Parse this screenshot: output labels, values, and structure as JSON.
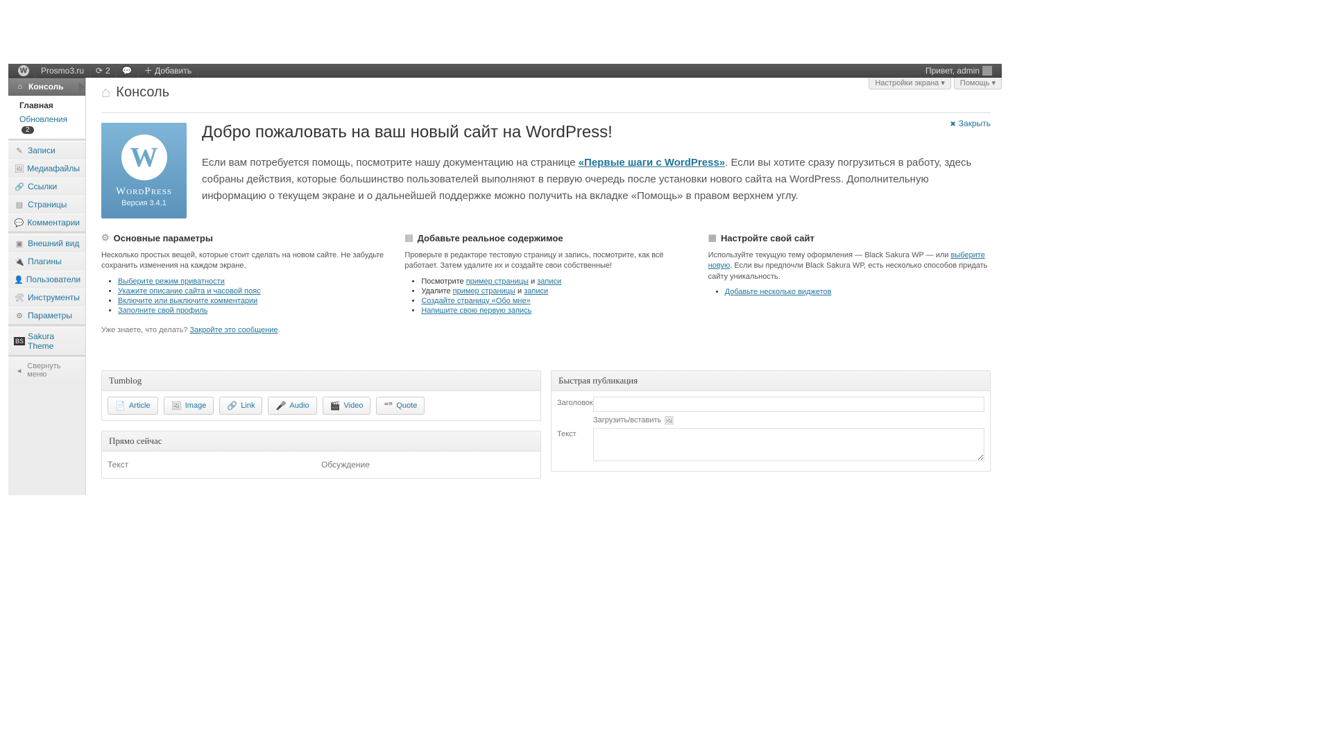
{
  "adminbar": {
    "site_name": "Prosmo3.ru",
    "updates_count": "2",
    "add_new": "Добавить",
    "greeting": "Привет, admin"
  },
  "screen_options": "Настройки экрана",
  "help": "Помощь",
  "sidebar": {
    "console": "Консоль",
    "main": "Главная",
    "updates": "Обновления",
    "updates_badge": "2",
    "posts": "Записи",
    "media": "Медиафайлы",
    "links": "Ссылки",
    "pages": "Страницы",
    "comments": "Комментарии",
    "appearance": "Внешний вид",
    "plugins": "Плагины",
    "users": "Пользователи",
    "tools": "Инструменты",
    "settings": "Параметры",
    "sakura": "Sakura Theme",
    "collapse": "Свернуть меню"
  },
  "page_title": "Консоль",
  "welcome": {
    "dismiss": "Закрыть",
    "badge_name": "WordPress",
    "badge_version": "Версия 3.4.1",
    "heading": "Добро пожаловать на ваш новый сайт на WordPress!",
    "intro_1": "Если вам потребуется помощь, посмотрите нашу документацию на странице ",
    "intro_link": "«Первые шаги с WordPress»",
    "intro_2": ". Если вы хотите сразу погрузиться в работу, здесь собраны действия, которые большинство пользователей выполняют в первую очередь после установки нового сайта на WordPress. Дополнительную информацию о текущем экране и о дальнейшей поддержке можно получить на вкладке «Помощь» в правом верхнем углу.",
    "col1": {
      "title": "Основные параметры",
      "desc": "Несколько простых вещей, которые стоит сделать на новом сайте. Не забудьте сохранить изменения на каждом экране.",
      "items": [
        "Выберите режим приватности",
        "Укажите описание сайта и часовой пояс",
        "Включите или выключите комментарии",
        "Заполните свой профиль"
      ]
    },
    "col2": {
      "title": "Добавьте реальное содержимое",
      "desc": "Проверьте в редакторе тестовую страницу и запись, посмотрите, как всё работает. Затем удалите их и создайте свои собственные!",
      "i1a": "Посмотрите ",
      "i1b": "пример страницы",
      "i1c": " и ",
      "i1d": "записи",
      "i2a": "Удалите ",
      "i2b": "пример страницы",
      "i2c": " и ",
      "i2d": "записи",
      "i3": "Создайте страницу «Обо мне»",
      "i4": "Напишите свою первую запись"
    },
    "col3": {
      "title": "Настройте свой сайт",
      "desc_a": "Используйте текущую тему оформления — Black Sakura WP — или ",
      "desc_link": "выберите новую",
      "desc_b": ". Если вы предпочли Black Sakura WP, есть несколько способов придать сайту уникальность.",
      "item1": "Добавьте несколько виджетов"
    },
    "footer_a": "Уже знаете, что делать? ",
    "footer_link": "Закройте это сообщение",
    "footer_b": "."
  },
  "tumblog": {
    "title": "Tumblog",
    "article": "Article",
    "image": "Image",
    "link": "Link",
    "audio": "Audio",
    "video": "Video",
    "quote": "Quote"
  },
  "rightnow": {
    "title": "Прямо сейчас",
    "col1": "Текст",
    "col2": "Обсуждение"
  },
  "quickpress": {
    "title": "Быстрая публикация",
    "title_label": "Заголовок",
    "upload": "Загрузить/вставить",
    "content_label": "Текст"
  }
}
